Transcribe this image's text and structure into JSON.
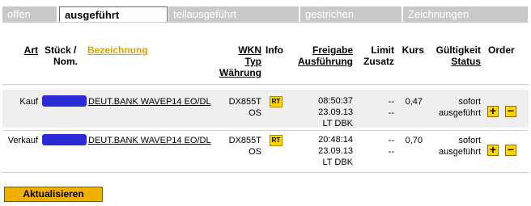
{
  "tabs": [
    {
      "label": "offen"
    },
    {
      "label": "ausgeführt"
    },
    {
      "label": "teilausgeführt"
    },
    {
      "label": "gestrichen"
    },
    {
      "label": "Zeichnungen"
    }
  ],
  "header": {
    "art": "Art",
    "stueck": "Stück /",
    "nom": "Nom.",
    "bezeichnung": "Bezeichnung",
    "wkn": "WKN",
    "typ": "Typ",
    "waehrung": "Währung",
    "info": "Info",
    "freigabe": "Freigabe",
    "ausfuehrung": "Ausführung",
    "limit": "Limit",
    "zusatz": "Zusatz",
    "kurs": "Kurs",
    "gueltigkeit": "Gültigkeit",
    "status": "Status",
    "order": "Order"
  },
  "orders": [
    {
      "art": "Kauf",
      "bezeichnung": "DEUT.BANK WAVEP14 EO/DL",
      "wkn": "DX855T",
      "typ": "OS",
      "info": "RT",
      "time": "08:50:37",
      "date": "23.09.13",
      "venue": "LT DBK",
      "limit": "--",
      "zusatz": "--",
      "kurs": "0,47",
      "gueltigkeit": "sofort",
      "status": "ausgeführt"
    },
    {
      "art": "Verkauf",
      "bezeichnung": "DEUT.BANK WAVEP14 EO/DL",
      "wkn": "DX855T",
      "typ": "OS",
      "info": "RT",
      "time": "20:48:14",
      "date": "23.09.13",
      "venue": "LT DBK",
      "limit": "--",
      "zusatz": "--",
      "kurs": "0,70",
      "gueltigkeit": "sofort",
      "status": "ausgeführt"
    }
  ],
  "actions": {
    "plus": "+",
    "minus": "−"
  },
  "refresh_label": "Aktualisieren",
  "colors": {
    "accent": "#f0b000",
    "tab_inactive": "#c9c9c9",
    "row_bg": "#efefef",
    "redaction": "#2b2bd6"
  }
}
